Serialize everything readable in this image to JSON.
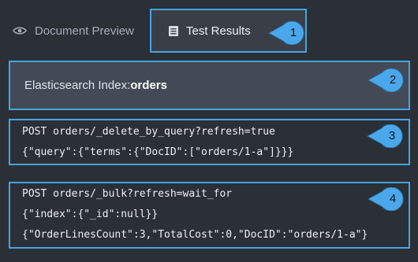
{
  "tabs": {
    "document_preview": {
      "label": "Document Preview",
      "icon": "eye-icon"
    },
    "test_results": {
      "label": "Test Results",
      "icon": "document-list-icon",
      "active": true
    }
  },
  "index_panel": {
    "label": "Elasticsearch Index: ",
    "value": "orders"
  },
  "delete_panel": {
    "lines": [
      "POST orders/_delete_by_query?refresh=true",
      "{\"query\":{\"terms\":{\"DocID\":[\"orders/1-a\"]}}}"
    ]
  },
  "bulk_panel": {
    "lines": [
      "POST orders/_bulk?refresh=wait_for",
      "{\"index\":{\"_id\":null}}",
      "{\"OrderLinesCount\":3,\"TotalCost\":0,\"DocID\":\"orders/1-a\"}"
    ]
  },
  "callouts": [
    "1",
    "2",
    "3",
    "4"
  ],
  "colors": {
    "accent": "#47a3e6",
    "callout_fill": "#4aa8ea",
    "background": "#2b2f36",
    "index_panel_bg": "#434a56"
  }
}
